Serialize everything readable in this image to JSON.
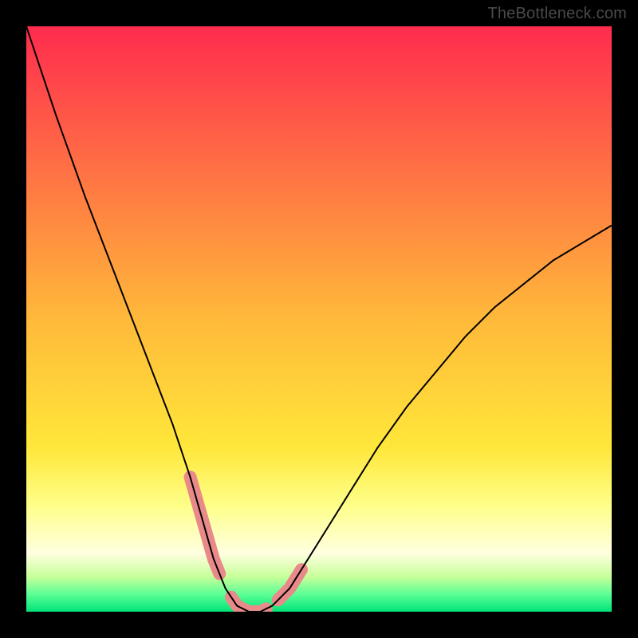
{
  "watermark": "TheBottleneck.com",
  "chart_data": {
    "type": "line",
    "title": "",
    "xlabel": "",
    "ylabel": "",
    "xlim": [
      0,
      100
    ],
    "ylim": [
      0,
      100
    ],
    "grid": false,
    "series": [
      {
        "name": "curve",
        "x": [
          0,
          5,
          10,
          15,
          20,
          25,
          28,
          30,
          32,
          34,
          36,
          38,
          40,
          42,
          45,
          50,
          55,
          60,
          65,
          70,
          75,
          80,
          85,
          90,
          95,
          100
        ],
        "values": [
          100,
          85,
          71,
          58,
          45,
          32,
          23,
          16,
          9,
          4,
          1,
          0,
          0,
          1,
          4,
          12,
          20,
          28,
          35,
          41,
          47,
          52,
          56,
          60,
          63,
          66
        ]
      }
    ],
    "highlight_segments": [
      {
        "x_start": 28,
        "x_end": 33
      },
      {
        "x_start": 35,
        "x_end": 41
      },
      {
        "x_start": 43,
        "x_end": 47
      }
    ],
    "background_gradient": {
      "stops": [
        {
          "offset": 0.0,
          "color": "#ff2b4e"
        },
        {
          "offset": 0.5,
          "color": "#ffb93a"
        },
        {
          "offset": 0.72,
          "color": "#ffe73a"
        },
        {
          "offset": 0.82,
          "color": "#feff8a"
        },
        {
          "offset": 0.9,
          "color": "#ffffe0"
        },
        {
          "offset": 0.94,
          "color": "#c8ff9a"
        },
        {
          "offset": 0.97,
          "color": "#5cff95"
        },
        {
          "offset": 1.0,
          "color": "#00e47a"
        }
      ]
    }
  }
}
